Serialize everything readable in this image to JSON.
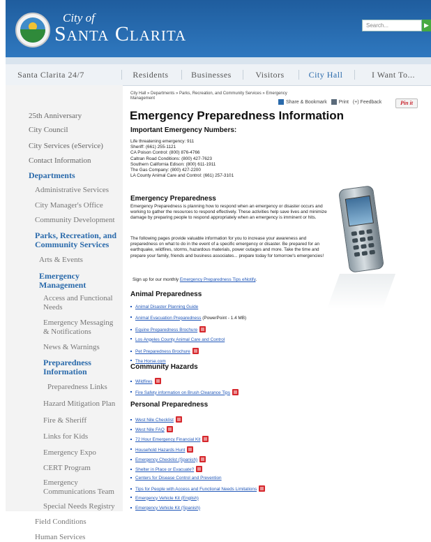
{
  "header": {
    "city_of": "City of",
    "city_name": "Santa Clarita",
    "search_placeholder": "Search...",
    "search_go": "▶"
  },
  "nav": {
    "items": [
      "Santa Clarita 24/7",
      "Residents",
      "Businesses",
      "Visitors",
      "City Hall",
      "I Want To..."
    ]
  },
  "sidebar": {
    "items": [
      "25th Anniversary",
      "City Council",
      "City Services (eService)",
      "Contact Information",
      "Departments",
      "Administrative Services",
      "City Manager's Office",
      "Community Development",
      "Parks, Recreation, and Community Services",
      "Arts & Events",
      "Emergency Management",
      "Access and Functional Needs",
      "Emergency Messaging & Notifications",
      "News & Warnings",
      "Preparedness Information",
      "Preparedness Links",
      "Hazard Mitigation Plan",
      "Fire & Sheriff",
      "Links for Kids",
      "Emergency Expo",
      "CERT Program",
      "Emergency Communications Team",
      "Special Needs Registry",
      "Field Conditions",
      "Human Services"
    ]
  },
  "breadcrumb": "City Hall » Departments » Parks, Recreation, and Community Services » Emergency Management",
  "tools": {
    "share": "Share & Bookmark",
    "print": "Print",
    "feedback": "(+) Feedback",
    "pinit": "Pin it"
  },
  "page": {
    "title": "Emergency Preparedness Information",
    "numbers_heading": "Important Emergency Numbers:",
    "numbers": [
      "Life threatening emergency: 911",
      "Sheriff: (661) 255-1121",
      "CA Poison Control: (800) 876-4766",
      "Caltran Road Conditions: (800) 427-7623",
      "Southern California Edison: (800) 611-1911",
      "The Gas Company: (800) 427-2200",
      "LA County Animal Care and Control: (661) 257-3101"
    ],
    "prep_heading": "Emergency Preparedness",
    "prep_para1": "Emergency Preparedness is planning how to respond when an emergency or disaster occurs and working to gather the resources to respond effectively. These activities help save lives and minimize damage by preparing people to respond appropriately when an emergency is imminent or hits.",
    "prep_para2": "The following pages provide valuable information for you to increase your awareness and preparedness on what to do in the event of a specific emergency or disaster. Be prepared for an earthquake, wildfires, storms, hazardous materials, power outages and more. Take the time and prepare your family, friends and business associates... prepare today for tomorrow's emergencies!",
    "signup_text": "Sign up for our monthly",
    "signup_link": "Emergency Preparedness Tips eNotify",
    "animal_heading": "Animal Preparedness",
    "animal_items": [
      {
        "text": "Animal Disaster Planning Guide",
        "suffix": "",
        "pdf": false
      },
      {
        "text": "Animal Evacuation Preparedness",
        "suffix": " (PowerPoint - 1.4 MB)",
        "pdf": false
      },
      {
        "text": "Equine Preparedness Brochure",
        "suffix": "",
        "pdf": true
      },
      {
        "text": "Los Angeles County Animal Care and Control",
        "suffix": "",
        "pdf": false
      },
      {
        "text": "Pet Preparedness Brochure",
        "suffix": "",
        "pdf": true
      },
      {
        "text": "The Horse.com",
        "suffix": "",
        "pdf": false
      }
    ],
    "hazards_heading": "Community Hazards",
    "hazard_items": [
      {
        "text": "Wildfires",
        "pdf": true
      },
      {
        "text": "Fire Safety information on Brush Clearance Tips",
        "pdf": true
      }
    ],
    "personal_heading": "Personal Preparedness",
    "personal_items": [
      {
        "text": "West Nile Checklist",
        "pdf": true
      },
      {
        "text": "West Nile FAQ",
        "pdf": true
      },
      {
        "text": "72 Hour Emergency Financial Kit",
        "pdf": true
      },
      {
        "text": "Household Hazards Hunt",
        "pdf": true
      },
      {
        "text": "Emergency Checklist (Spanish)",
        "pdf": true
      },
      {
        "text": "Shelter in Place or Evacuate?",
        "pdf": true
      },
      {
        "text": "Centers for Disease Control and Prevention",
        "pdf": false
      },
      {
        "text": "Tips for People with Access and Functional Needs Limitations",
        "pdf": true
      },
      {
        "text": "Emergency Vehicle Kit (English)",
        "pdf": false
      },
      {
        "text": "Emergency Vehicle Kit (Spanish)",
        "pdf": false
      }
    ]
  }
}
